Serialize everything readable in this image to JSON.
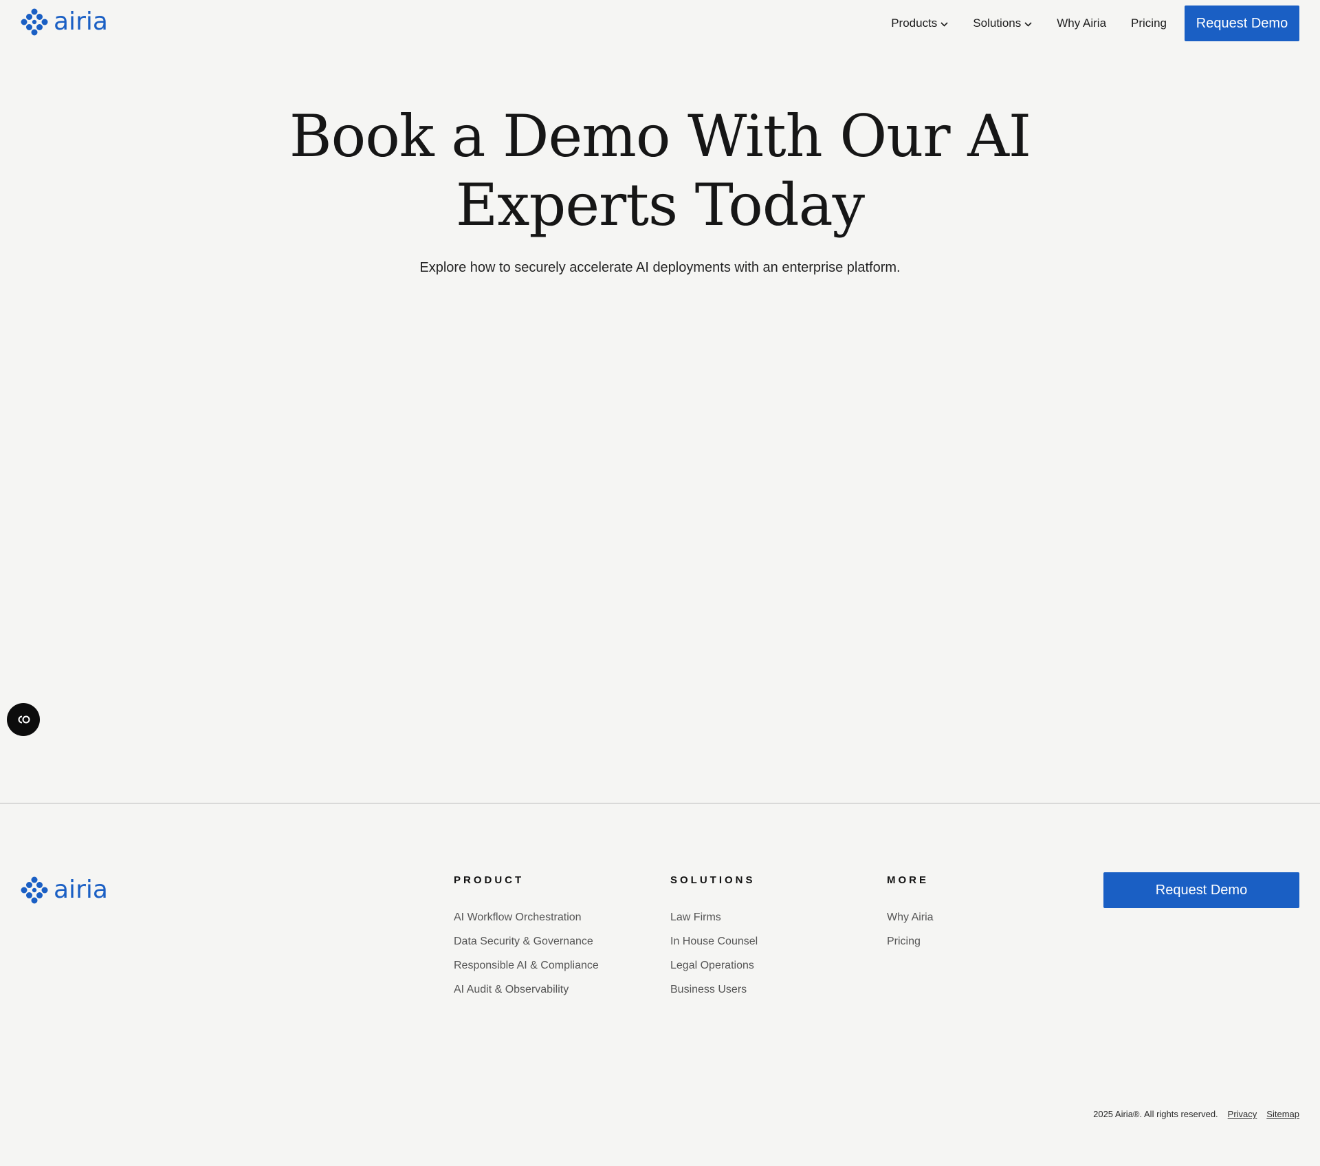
{
  "brand": {
    "name": "airia",
    "color": "#1a5fc4"
  },
  "nav": {
    "products_label": "Products",
    "solutions_label": "Solutions",
    "why_label": "Why Airia",
    "pricing_label": "Pricing",
    "cta_label": "Request Demo"
  },
  "hero": {
    "title_line1": "Book a Demo With Our AI",
    "title_line2": "Experts Today",
    "subtitle": "Explore how to securely accelerate AI deployments with an enterprise platform."
  },
  "footer": {
    "cta_label": "Request Demo",
    "product": {
      "heading": "PRODUCT",
      "links": [
        "AI Workflow Orchestration",
        "Data Security & Governance",
        "Responsible AI & Compliance",
        "AI Audit & Observability"
      ]
    },
    "solutions": {
      "heading": "SOLUTIONS",
      "links": [
        "Law Firms",
        "In House Counsel",
        "Legal Operations",
        "Business Users"
      ]
    },
    "more": {
      "heading": "MORE",
      "links": [
        "Why Airia",
        "Pricing"
      ]
    },
    "copyright": "2025 Airia®. All rights reserved.",
    "privacy_label": "Privacy",
    "sitemap_label": "Sitemap"
  },
  "icons": {
    "accessibility": "accessibility-icon",
    "chevron": "chevron-down-icon",
    "logo": "airia-logo-icon"
  }
}
